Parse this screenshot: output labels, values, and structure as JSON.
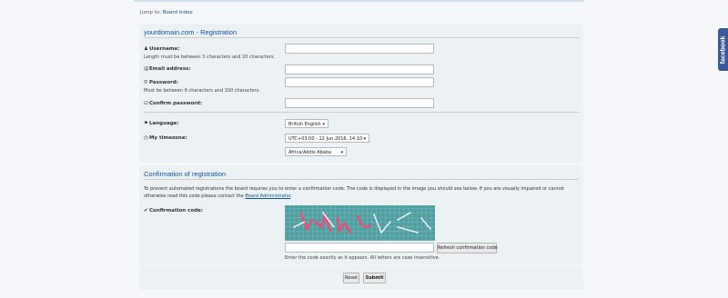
{
  "jump": {
    "prefix": "Jump to:",
    "link": "Board index"
  },
  "registration": {
    "title": "yourdomain.com - Registration",
    "username": {
      "icon": "user-icon",
      "label": "Username:",
      "hint": "Length must be between 3 characters and 20 characters.",
      "value": ""
    },
    "email": {
      "icon": "at-icon",
      "label": "Email address:",
      "value": ""
    },
    "password": {
      "icon": "key-icon",
      "label": "Password:",
      "hint": "Must be between 6 characters and 100 characters.",
      "value": ""
    },
    "confirm_password": {
      "icon": "check-square-icon",
      "label": "Confirm password:",
      "value": ""
    },
    "language": {
      "icon": "flag-icon",
      "label": "Language:",
      "selected": "British English"
    },
    "timezone": {
      "icon": "clock-icon",
      "label": "My timezone:",
      "selected": "UTC+03:00 - 12 Jun 2016, 14:10",
      "region": "Africa/Addis Ababa"
    }
  },
  "confirmation": {
    "title": "Confirmation of registration",
    "text_before": "To prevent automated registrations the board requires you to enter a confirmation code. The code is displayed in the image you should see below. If you are visually impaired or cannot otherwise read this code please contact the",
    "admin_link": "Board Administrator",
    "text_after": ".",
    "code_label": "Confirmation code:",
    "code_icon": "check-circle-icon",
    "refresh_button": "Refresh confirmation code",
    "code_hint": "Enter the code exactly as it appears. All letters are case insensitive.",
    "captcha_colors": {
      "background": "#4f9fa3",
      "pink": "#e84f7a",
      "white": "#f2f2f2"
    }
  },
  "actions": {
    "reset": "Reset",
    "submit": "Submit"
  },
  "facebook": {
    "label": "facebook",
    "color": "#3b5998"
  }
}
